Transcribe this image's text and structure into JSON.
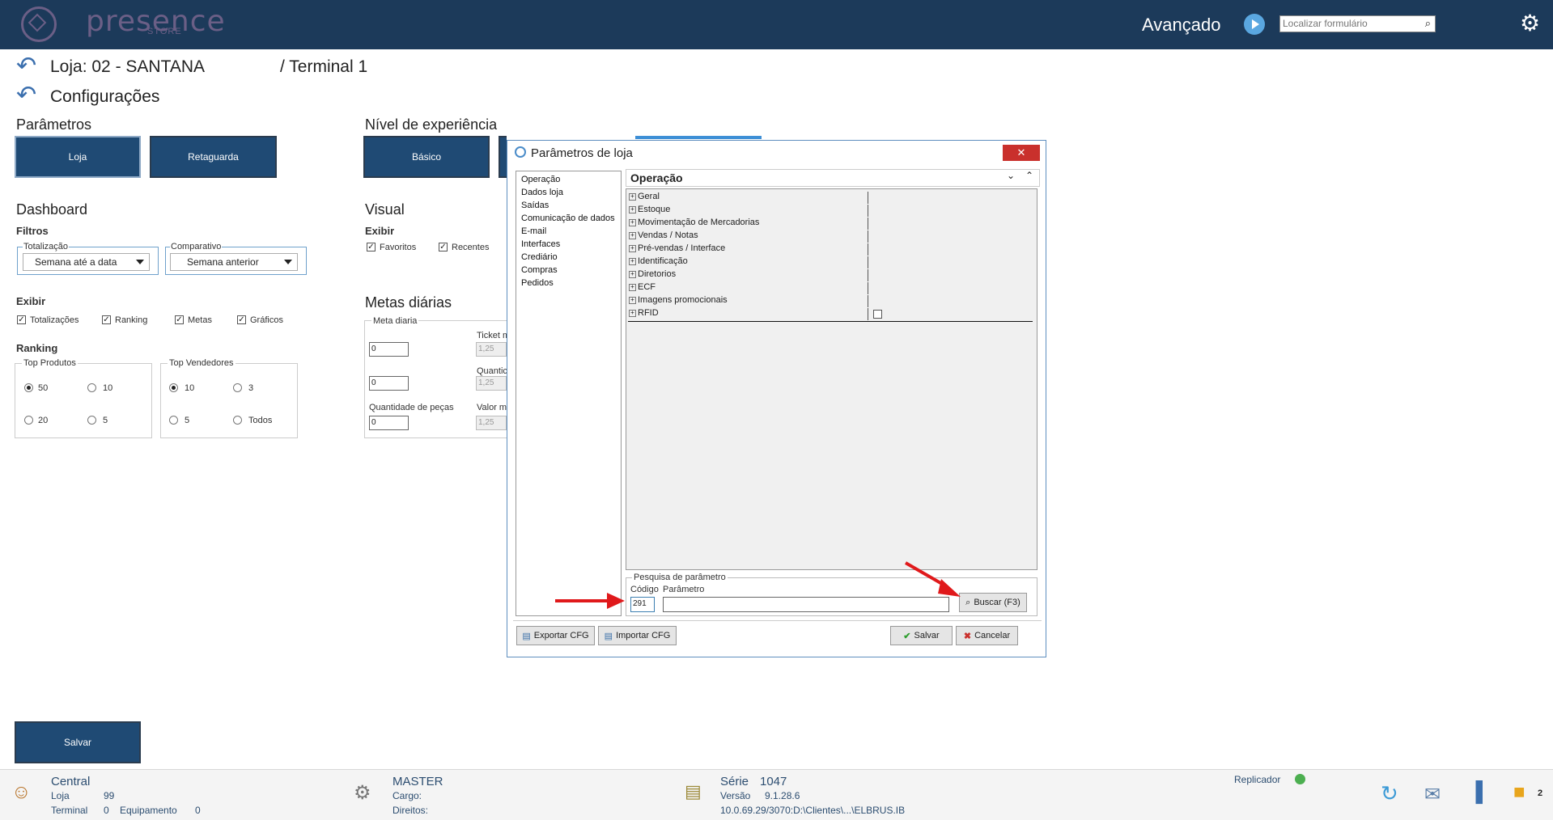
{
  "header": {
    "logo_text": "presence",
    "logo_sub": "STORE",
    "mode_label": "Avançado",
    "search_placeholder": "Localizar formulário"
  },
  "breadcrumb": {
    "store": "Loja: 02 - SANTANA",
    "terminal": "/ Terminal 1",
    "page": "Configurações"
  },
  "parametros": {
    "title": "Parâmetros",
    "loja_btn": "Loja",
    "retaguarda_btn": "Retaguarda"
  },
  "nivel": {
    "title": "Nível de experiência",
    "basico_btn": "Básico"
  },
  "dashboard": {
    "title": "Dashboard",
    "filtros": "Filtros",
    "totalizacao_label": "Totalização",
    "totalizacao_value": "Semana até a data",
    "comparativo_label": "Comparativo",
    "comparativo_value": "Semana anterior",
    "exibir": "Exibir",
    "checks": [
      "Totalizações",
      "Ranking",
      "Metas",
      "Gráficos"
    ],
    "ranking": "Ranking",
    "top_produtos": "Top Produtos",
    "top_produtos_opts": [
      "50",
      "10",
      "20",
      "5"
    ],
    "top_vendedores": "Top Vendedores",
    "top_vendedores_opts": [
      "10",
      "3",
      "5",
      "Todos"
    ]
  },
  "visual": {
    "title": "Visual",
    "exibir": "Exibir",
    "checks": [
      "Favoritos",
      "Recentes"
    ]
  },
  "metas": {
    "title": "Metas diárias",
    "meta_diaria": "Meta diaria",
    "ticket": "Ticket m",
    "quanti": "Quantic",
    "qtd_pecas": "Quantidade de peças",
    "valor": "Valor m",
    "v1": "0",
    "v2": "0",
    "v3": "0",
    "d1": "1,25",
    "d2": "1,25",
    "d3": "1,25"
  },
  "dialog": {
    "title": "Parâmetros de loja",
    "close": "✕",
    "left_items": [
      "Operação",
      "Dados loja",
      "Saídas",
      "Comunicação de dados",
      "E-mail",
      "Interfaces",
      "Crediário",
      "Compras",
      "Pedidos"
    ],
    "section_title": "Operação",
    "rows": [
      "Geral",
      "Estoque",
      "Movimentação de Mercadorias",
      "Vendas / Notas",
      "Pré-vendas / Interface",
      "Identificação",
      "Diretorios",
      "ECF",
      "Imagens promocionais",
      "RFID"
    ],
    "search_group": "Pesquisa de parâmetro",
    "codigo_label": "Código",
    "parametro_label": "Parâmetro",
    "codigo_value": "291",
    "buscar_btn": "Buscar (F3)",
    "exportar_btn": "Exportar CFG",
    "importar_btn": "Importar CFG",
    "salvar_btn": "Salvar",
    "cancelar_btn": "Cancelar"
  },
  "save_button": "Salvar",
  "status": {
    "central": "Central",
    "loja_label": "Loja",
    "loja_value": "99",
    "terminal_label": "Terminal",
    "terminal_value": "0",
    "equip_label": "Equipamento",
    "equip_value": "0",
    "user": "MASTER",
    "cargo": "Cargo:",
    "direitos": "Direitos:",
    "serie_label": "Série",
    "serie_value": "1047",
    "versao_label": "Versão",
    "versao_value": "9.1.28.6",
    "path": "10.0.69.29/3070:D:\\Clientes\\...\\ELBRUS.IB",
    "replicador": "Replicador",
    "notif_count": "2"
  },
  "colors": {
    "topbar": "#1c3a5a",
    "navy_button": "#1f4a74",
    "close_red": "#c9302c",
    "arrow_red": "#e0191b",
    "replicador_green": "#4caf50"
  }
}
